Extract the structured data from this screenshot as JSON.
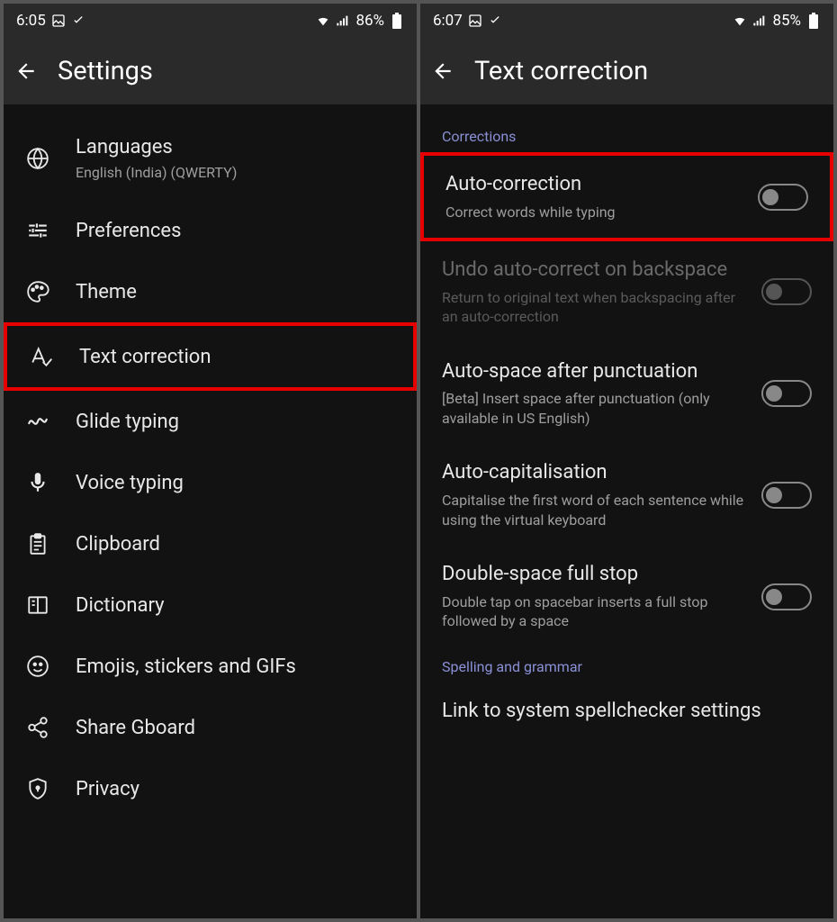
{
  "left": {
    "status": {
      "time": "6:05",
      "battery": "86%"
    },
    "title": "Settings",
    "items": [
      {
        "title": "Languages",
        "sub": "English (India) (QWERTY)"
      },
      {
        "title": "Preferences"
      },
      {
        "title": "Theme"
      },
      {
        "title": "Text correction"
      },
      {
        "title": "Glide typing"
      },
      {
        "title": "Voice typing"
      },
      {
        "title": "Clipboard"
      },
      {
        "title": "Dictionary"
      },
      {
        "title": "Emojis, stickers and GIFs"
      },
      {
        "title": "Share Gboard"
      },
      {
        "title": "Privacy"
      }
    ]
  },
  "right": {
    "status": {
      "time": "6:07",
      "battery": "85%"
    },
    "title": "Text correction",
    "section1": "Corrections",
    "section2": "Spelling and grammar",
    "items": [
      {
        "title": "Auto-correction",
        "sub": "Correct words while typing"
      },
      {
        "title": "Undo auto-correct on backspace",
        "sub": "Return to original text when backspacing after an auto-correction"
      },
      {
        "title": "Auto-space after punctuation",
        "sub": "[Beta] Insert space after punctuation (only available in US English)"
      },
      {
        "title": "Auto-capitalisation",
        "sub": "Capitalise the first word of each sentence while using the virtual keyboard"
      },
      {
        "title": "Double-space full stop",
        "sub": "Double tap on spacebar inserts a full stop followed by a space"
      }
    ],
    "lastItem": {
      "title": "Link to system spellchecker settings"
    }
  }
}
